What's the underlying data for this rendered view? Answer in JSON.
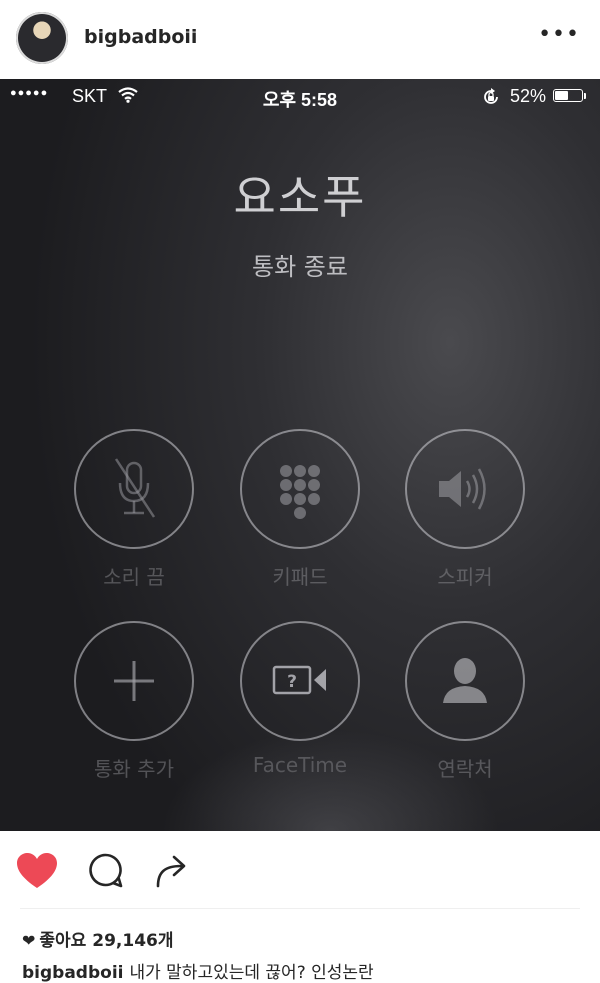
{
  "post": {
    "username": "bigbadboii",
    "more_icon": "more-horizontal-icon",
    "likes_text": "좋아요 29,146개",
    "caption_user": "bigbadboii",
    "caption_text": "내가 말하고있는데 끊어? 인성논란",
    "like_color": "#ed4956"
  },
  "phone": {
    "status_bar": {
      "signal": "●●●●●",
      "carrier": "SKT",
      "time": "오후 5:58",
      "battery_percent": "52%",
      "battery_level": 0.52
    },
    "caller_name": "요소푸",
    "call_status": "통화 종료",
    "buttons": [
      {
        "label": "소리 끔",
        "icon": "mute-microphone-icon"
      },
      {
        "label": "키패드",
        "icon": "keypad-icon"
      },
      {
        "label": "스피커",
        "icon": "speaker-icon"
      },
      {
        "label": "통화 추가",
        "icon": "add-call-icon"
      },
      {
        "label": "FaceTime",
        "icon": "facetime-icon"
      },
      {
        "label": "연락처",
        "icon": "contacts-icon"
      }
    ]
  }
}
